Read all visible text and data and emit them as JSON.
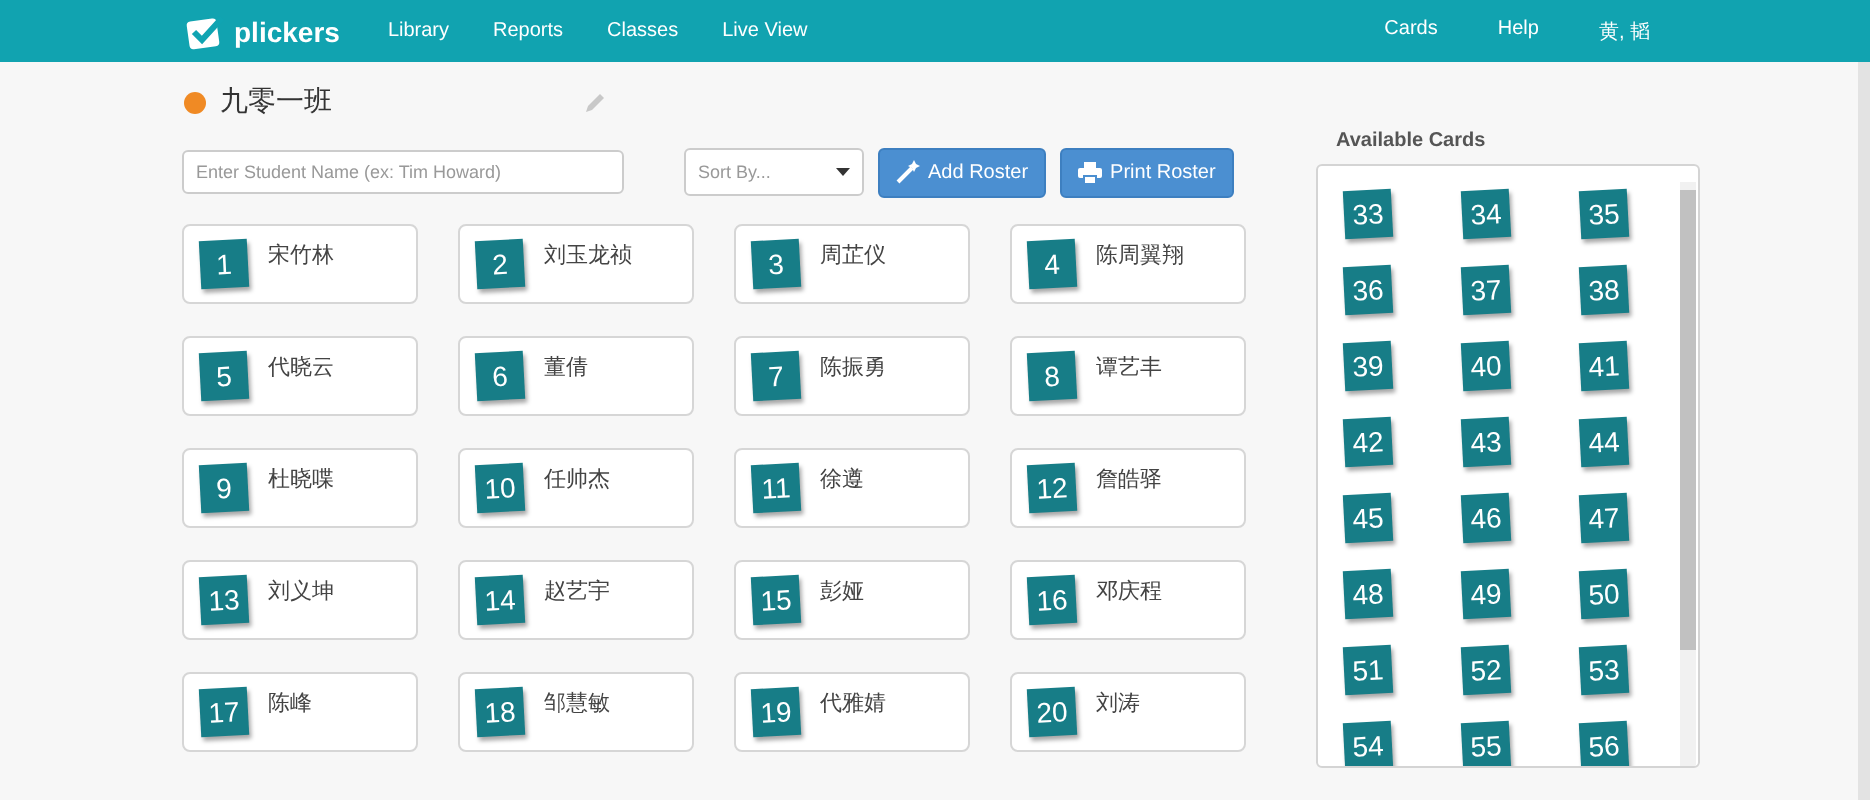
{
  "nav": {
    "logo": "plickers",
    "links": [
      "Library",
      "Reports",
      "Classes",
      "Live View"
    ],
    "right_links": [
      "Cards",
      "Help"
    ],
    "user": "黄, 韬"
  },
  "class": {
    "name": "九零一班"
  },
  "search": {
    "placeholder": "Enter Student Name (ex: Tim Howard)"
  },
  "sort": {
    "value": "Sort By..."
  },
  "buttons": [
    "Add Roster",
    "Print Roster"
  ],
  "students": [
    {
      "card": "1",
      "name": "宋竹林"
    },
    {
      "card": "2",
      "name": "刘玉龙祯"
    },
    {
      "card": "3",
      "name": "周芷仪"
    },
    {
      "card": "4",
      "name": "陈周翼翔"
    },
    {
      "card": "5",
      "name": "代晓云"
    },
    {
      "card": "6",
      "name": "董倩"
    },
    {
      "card": "7",
      "name": "陈振勇"
    },
    {
      "card": "8",
      "name": "谭艺丰"
    },
    {
      "card": "9",
      "name": "杜晓喋"
    },
    {
      "card": "10",
      "name": "任帅杰"
    },
    {
      "card": "11",
      "name": "徐遵"
    },
    {
      "card": "12",
      "name": "詹皓驿"
    },
    {
      "card": "13",
      "name": "刘义坤"
    },
    {
      "card": "14",
      "name": "赵艺宇"
    },
    {
      "card": "15",
      "name": "彭娅"
    },
    {
      "card": "16",
      "name": "邓庆程"
    },
    {
      "card": "17",
      "name": "陈峰"
    },
    {
      "card": "18",
      "name": "邹慧敏"
    },
    {
      "card": "19",
      "name": "代雅婧"
    },
    {
      "card": "20",
      "name": "刘涛"
    }
  ],
  "available_cards": {
    "title": "Available Cards",
    "cards": [
      "33",
      "34",
      "35",
      "36",
      "37",
      "38",
      "39",
      "40",
      "41",
      "42",
      "43",
      "44",
      "45",
      "46",
      "47",
      "48",
      "49",
      "50",
      "51",
      "52",
      "53",
      "54",
      "55",
      "56"
    ]
  }
}
